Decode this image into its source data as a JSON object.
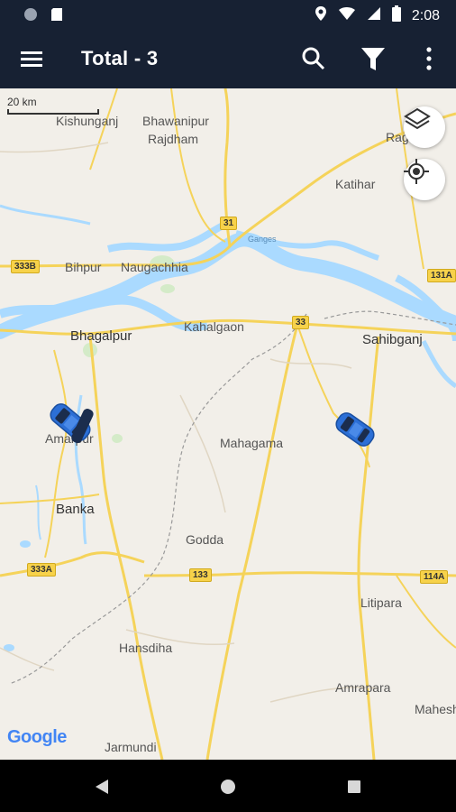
{
  "status_bar": {
    "time": "2:08"
  },
  "app_bar": {
    "title": "Total - 3"
  },
  "map": {
    "scale_label": "20 km",
    "attribution": "Google",
    "places": {
      "kishunganj": "Kishunganj",
      "bhawanipur": "Bhawanipur",
      "rajdham": "Rajdham",
      "ragha": "Rag",
      "katihar": "Katihar",
      "bihpur": "Bihpur",
      "naugachhia": "Naugachhia",
      "ganges": "Ganges",
      "bhagalpur": "Bhagalpur",
      "kahalgaon": "Kahalgaon",
      "sahibganj": "Sahibganj",
      "amarpur": "Amarpur",
      "mahagama": "Mahagama",
      "banka": "Banka",
      "godda": "Godda",
      "litipara": "Litipara",
      "hansdiha": "Hansdiha",
      "amrapara": "Amrapara",
      "maheshpur": "Mahesh",
      "jarmundi": "Jarmundi"
    },
    "highways": {
      "h31": "31",
      "h333b": "333B",
      "h131a": "131A",
      "h33": "33",
      "h333a": "333A",
      "h133": "133",
      "h114a": "114A"
    }
  },
  "colors": {
    "app_bar": "#172133",
    "road": "#f5d35a",
    "water": "#aadaff",
    "land": "#f2efe9",
    "car": "#2c6fd6"
  }
}
